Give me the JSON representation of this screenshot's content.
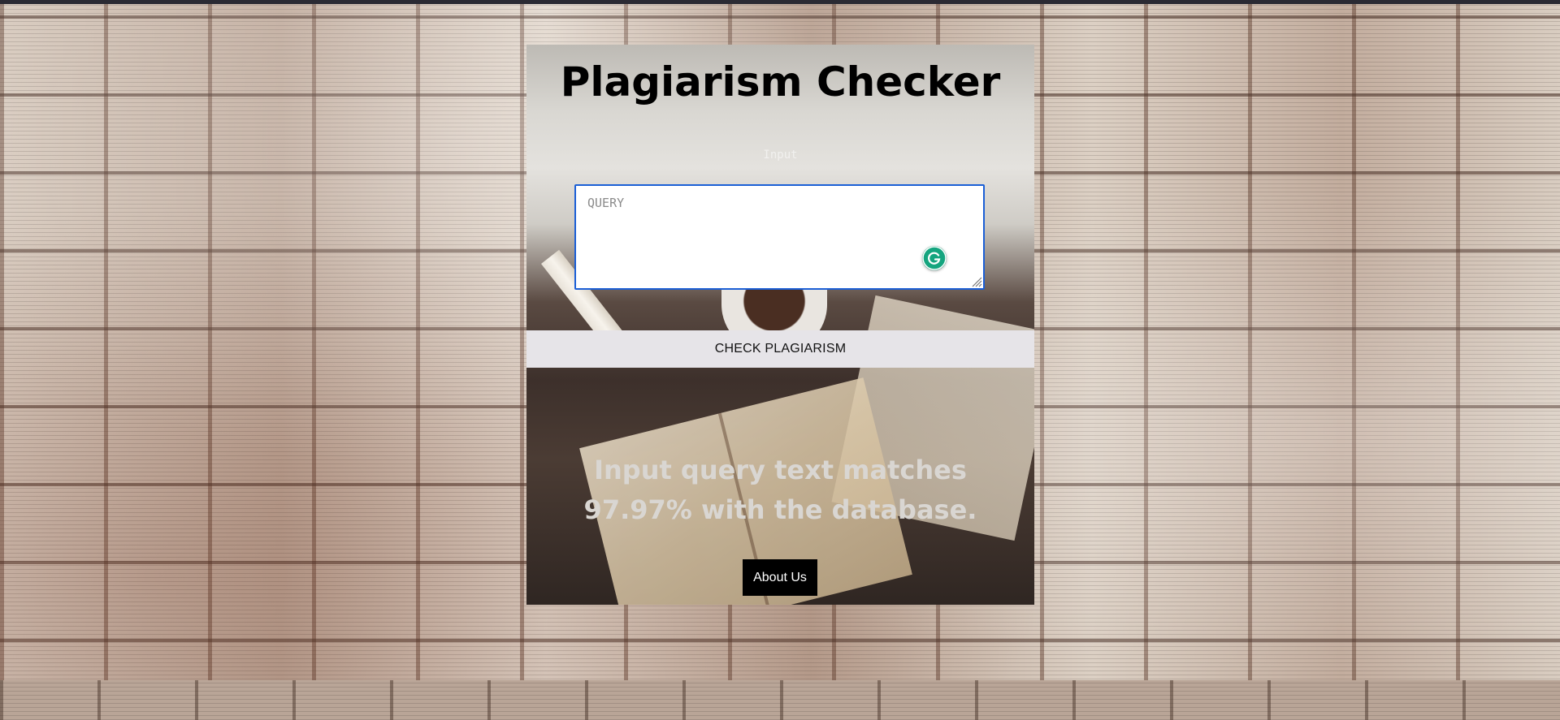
{
  "app": {
    "title": "Plagiarism Checker"
  },
  "form": {
    "input_label": "Input",
    "query_placeholder": "QUERY",
    "query_value": "",
    "submit_label": "CHECK PLAGIARISM"
  },
  "result": {
    "text": "Input query text matches 97.97% with the database."
  },
  "footer": {
    "about_label": "About Us"
  },
  "icons": {
    "assistant": "grammar-assistant-icon",
    "resize": "resize-grip-icon"
  },
  "colors": {
    "title": "#000000",
    "input_border": "#1b5fd6",
    "assistant_badge": "#15a57f",
    "submit_bg": "#e6e4e8",
    "result_text": "#d9d6d2",
    "about_bg": "#000000",
    "about_text": "#ffffff"
  }
}
